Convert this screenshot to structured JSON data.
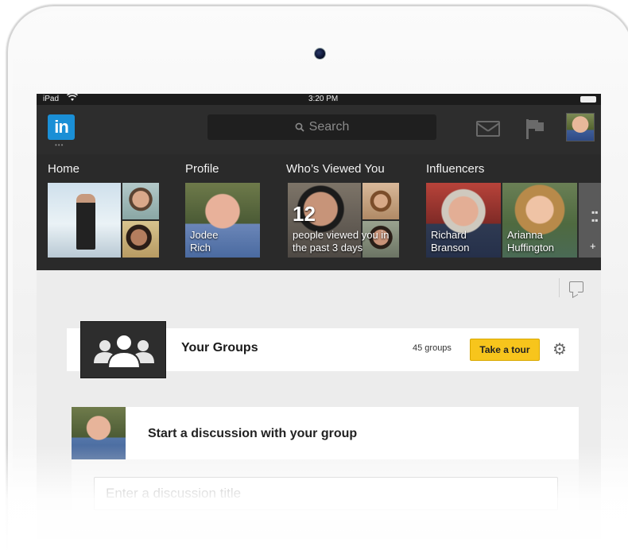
{
  "status_bar": {
    "device": "iPad",
    "time": "3:20 PM",
    "wifi_icon": "wifi-icon",
    "battery_icon": "battery-icon"
  },
  "nav": {
    "logo_text": "in",
    "logo_color": "#1a8fd6",
    "logo_dots": "•••",
    "search_placeholder": "Search",
    "search_icon": "⚲",
    "icons": [
      "mail-icon",
      "flag-icon",
      "avatar"
    ]
  },
  "highlights": {
    "home_label": "Home",
    "profile_label": "Profile",
    "profile_name": "Jodee Rich",
    "viewed_label": "Who’s Viewed You",
    "viewed_count": "12",
    "viewed_caption": "people viewed you in the past 3 days",
    "influencers_label": "Influencers",
    "influencer_1": "Richard Branson",
    "influencer_2": "Arianna Huffington",
    "more_plus": "+"
  },
  "groups": {
    "title": "Your Groups",
    "count": "45 groups",
    "tour_button": "Take a tour",
    "accent": "#f7c51c"
  },
  "discussion": {
    "title": "Start a discussion with your group",
    "input_placeholder": "Enter a discussion title"
  }
}
